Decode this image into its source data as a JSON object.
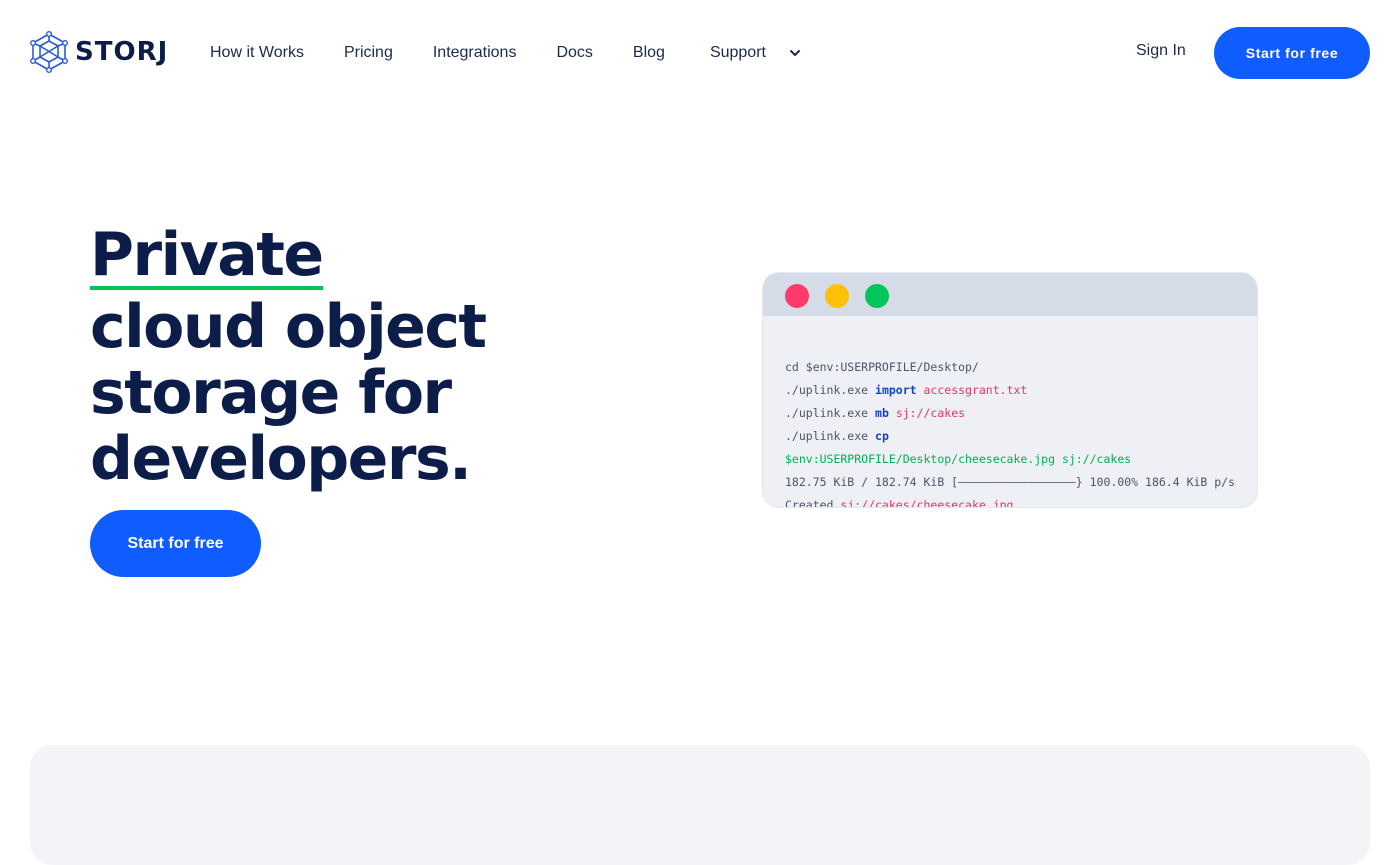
{
  "brand": {
    "name": "STORJ",
    "logo_icon": "storj-cube-icon",
    "color_primary": "#0f5cff",
    "color_navy": "#0c1d4a",
    "color_underline": "#00c455"
  },
  "nav": {
    "items": [
      {
        "label": "How it Works"
      },
      {
        "label": "Pricing"
      },
      {
        "label": "Integrations"
      },
      {
        "label": "Docs"
      },
      {
        "label": "Blog"
      },
      {
        "label": "Support",
        "icon": "chevron-down-icon"
      }
    ],
    "sign_in": "Sign In",
    "cta": "Start for free"
  },
  "hero": {
    "line1": "Private",
    "line2": "cloud object",
    "line3": "storage for",
    "line4": "developers.",
    "cta": "Start for free"
  },
  "terminal": {
    "dots": [
      "#ff3b6b",
      "#ffc107",
      "#00c55a"
    ],
    "lines": [
      {
        "cmd": "cd $env:USERPROFILE/Desktop/"
      },
      {
        "cmd": "./uplink.exe ",
        "kw": "import",
        "arg": "accessgrant.txt"
      },
      {
        "cmd": "./uplink.exe ",
        "kw": "mb",
        "arg": "sj://cakes"
      },
      {
        "cmd": "./uplink.exe ",
        "kw": "cp"
      },
      {
        "path": "$env:USERPROFILE/Desktop/cheesecake.jpg sj://cakes"
      },
      {
        "cmd": "182.75 KiB / 182.74 KiB [—————————————————} 100.00% 186.4 KiB p/s"
      },
      {
        "cmd": "Created ",
        "arg": "sj://cakes/cheesecake.jpg"
      }
    ]
  }
}
